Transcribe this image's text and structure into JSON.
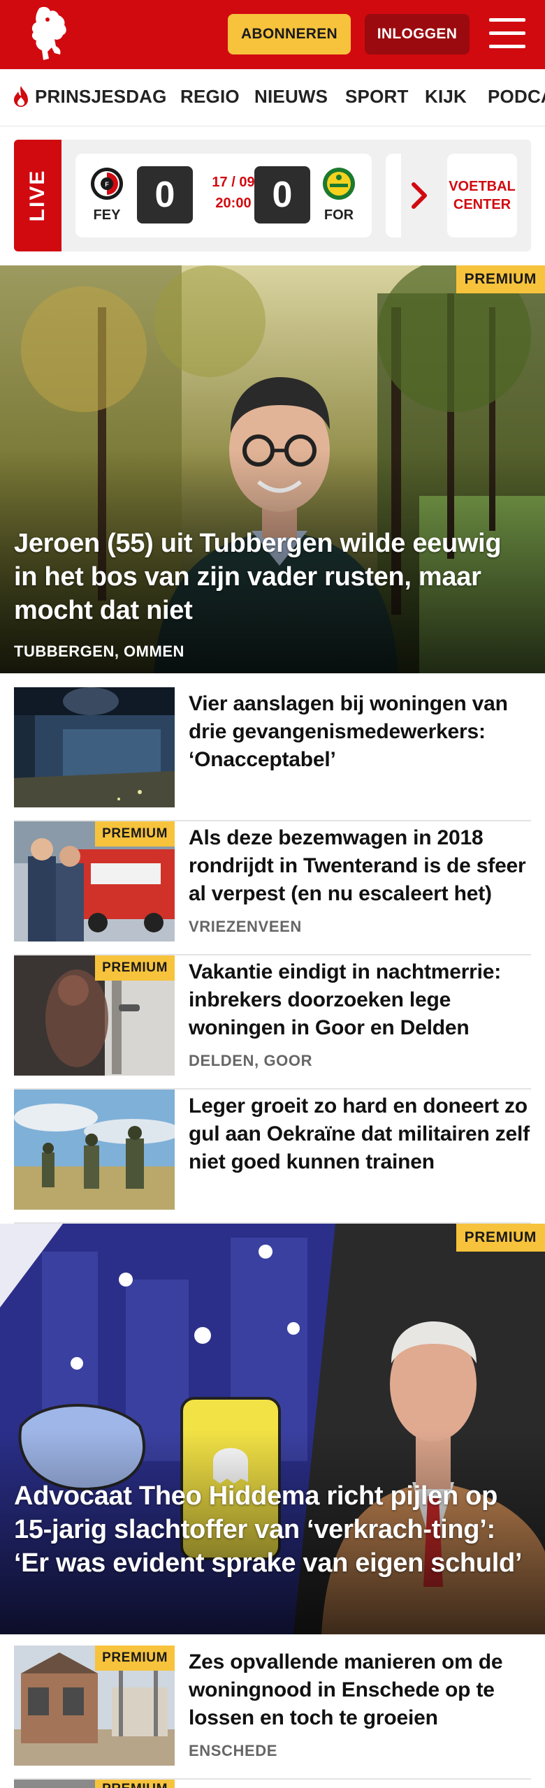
{
  "header": {
    "subscribe_label": "ABONNEREN",
    "login_label": "INLOGGEN",
    "brand_color": "#d10a10",
    "accent_color": "#f7c33c"
  },
  "nav": {
    "items": [
      "PRINSJESDAG",
      "REGIO",
      "NIEUWS",
      "SPORT",
      "KIJK",
      "PODCAST"
    ]
  },
  "live": {
    "label": "LIVE",
    "match": {
      "home": "FEY",
      "away": "FOR",
      "home_score": "0",
      "away_score": "0",
      "date": "17 / 09",
      "time": "20:00"
    },
    "voetbal_center": "VOETBAL CENTER"
  },
  "hero1": {
    "badge": "PREMIUM",
    "title": "Jeroen (55) uit Tubbergen wilde eeuwig in het bos van zijn vader rusten, maar mocht dat niet",
    "location": "TUBBERGEN, OMMEN"
  },
  "articles": [
    {
      "title": "Vier aanslagen bij woningen van drie gevangenismedewerkers: ‘Onacceptabel’",
      "location": "",
      "badge": ""
    },
    {
      "title": "Als deze bezemwagen in 2018 rondrijdt in Twenterand is de sfeer al verpest (en nu escaleert het)",
      "location": "VRIEZENVEEN",
      "badge": "PREMIUM"
    },
    {
      "title": "Vakantie eindigt in nachtmerrie: inbrekers doorzoeken lege woningen in Goor en Delden",
      "location": "DELDEN, GOOR",
      "badge": "PREMIUM"
    },
    {
      "title": "Leger groeit zo hard en doneert zo gul aan Oekraïne dat militairen zelf niet goed kunnen trainen",
      "location": "",
      "badge": ""
    }
  ],
  "hero2": {
    "badge": "PREMIUM",
    "title": "Advocaat Theo Hiddema richt pijlen op 15-jarig slachtoffer van ‘verkrach-ting’: ‘Er was evident sprake van eigen schuld’"
  },
  "articles2": [
    {
      "title": "Zes opvallende manieren om de woningnood in Enschede op te lossen en toch te groeien",
      "location": "ENSCHEDE",
      "badge": "PREMIUM"
    }
  ],
  "partial_badge": "PREMIUM"
}
